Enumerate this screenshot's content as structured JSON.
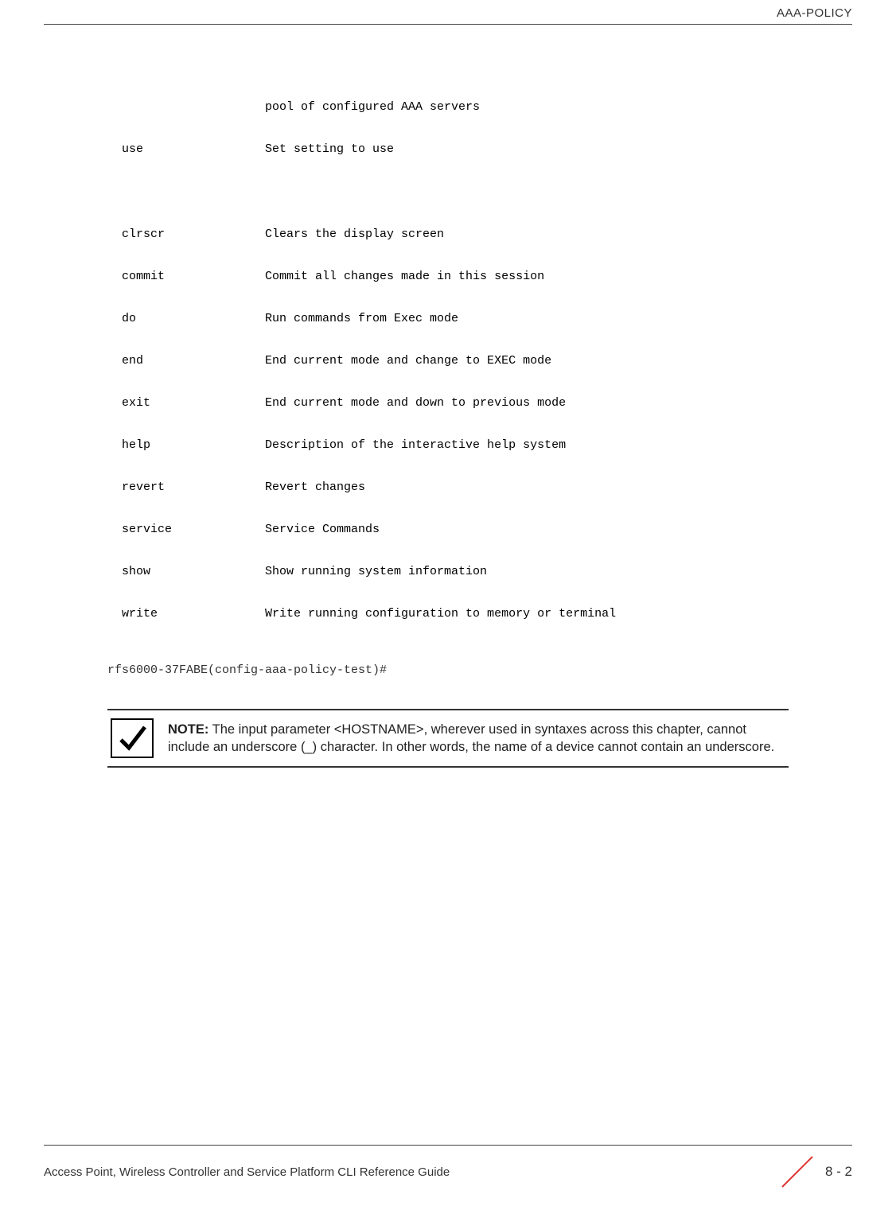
{
  "header": {
    "section": "AAA-POLICY"
  },
  "commands": {
    "pre_desc": "pool of configured AAA servers",
    "rows": [
      {
        "name": "use",
        "desc": "Set setting to use"
      }
    ],
    "rows2": [
      {
        "name": "clrscr",
        "desc": "Clears the display screen"
      },
      {
        "name": "commit",
        "desc": "Commit all changes made in this session"
      },
      {
        "name": "do",
        "desc": "Run commands from Exec mode"
      },
      {
        "name": "end",
        "desc": "End current mode and change to EXEC mode"
      },
      {
        "name": "exit",
        "desc": "End current mode and down to previous mode"
      },
      {
        "name": "help",
        "desc": "Description of the interactive help system"
      },
      {
        "name": "revert",
        "desc": "Revert changes"
      },
      {
        "name": "service",
        "desc": "Service Commands"
      },
      {
        "name": "show",
        "desc": "Show running system information"
      },
      {
        "name": "write",
        "desc": "Write running configuration to memory or terminal"
      }
    ]
  },
  "prompt": "rfs6000-37FABE(config-aaa-policy-test)#",
  "note": {
    "label": "NOTE:",
    "text": " The input parameter <HOSTNAME>, wherever used in syntaxes across this chapter, cannot include an underscore (_) character. In other words, the name of a device cannot contain an underscore."
  },
  "footer": {
    "title": "Access Point, Wireless Controller and Service Platform CLI Reference Guide",
    "page": "8 - 2"
  }
}
